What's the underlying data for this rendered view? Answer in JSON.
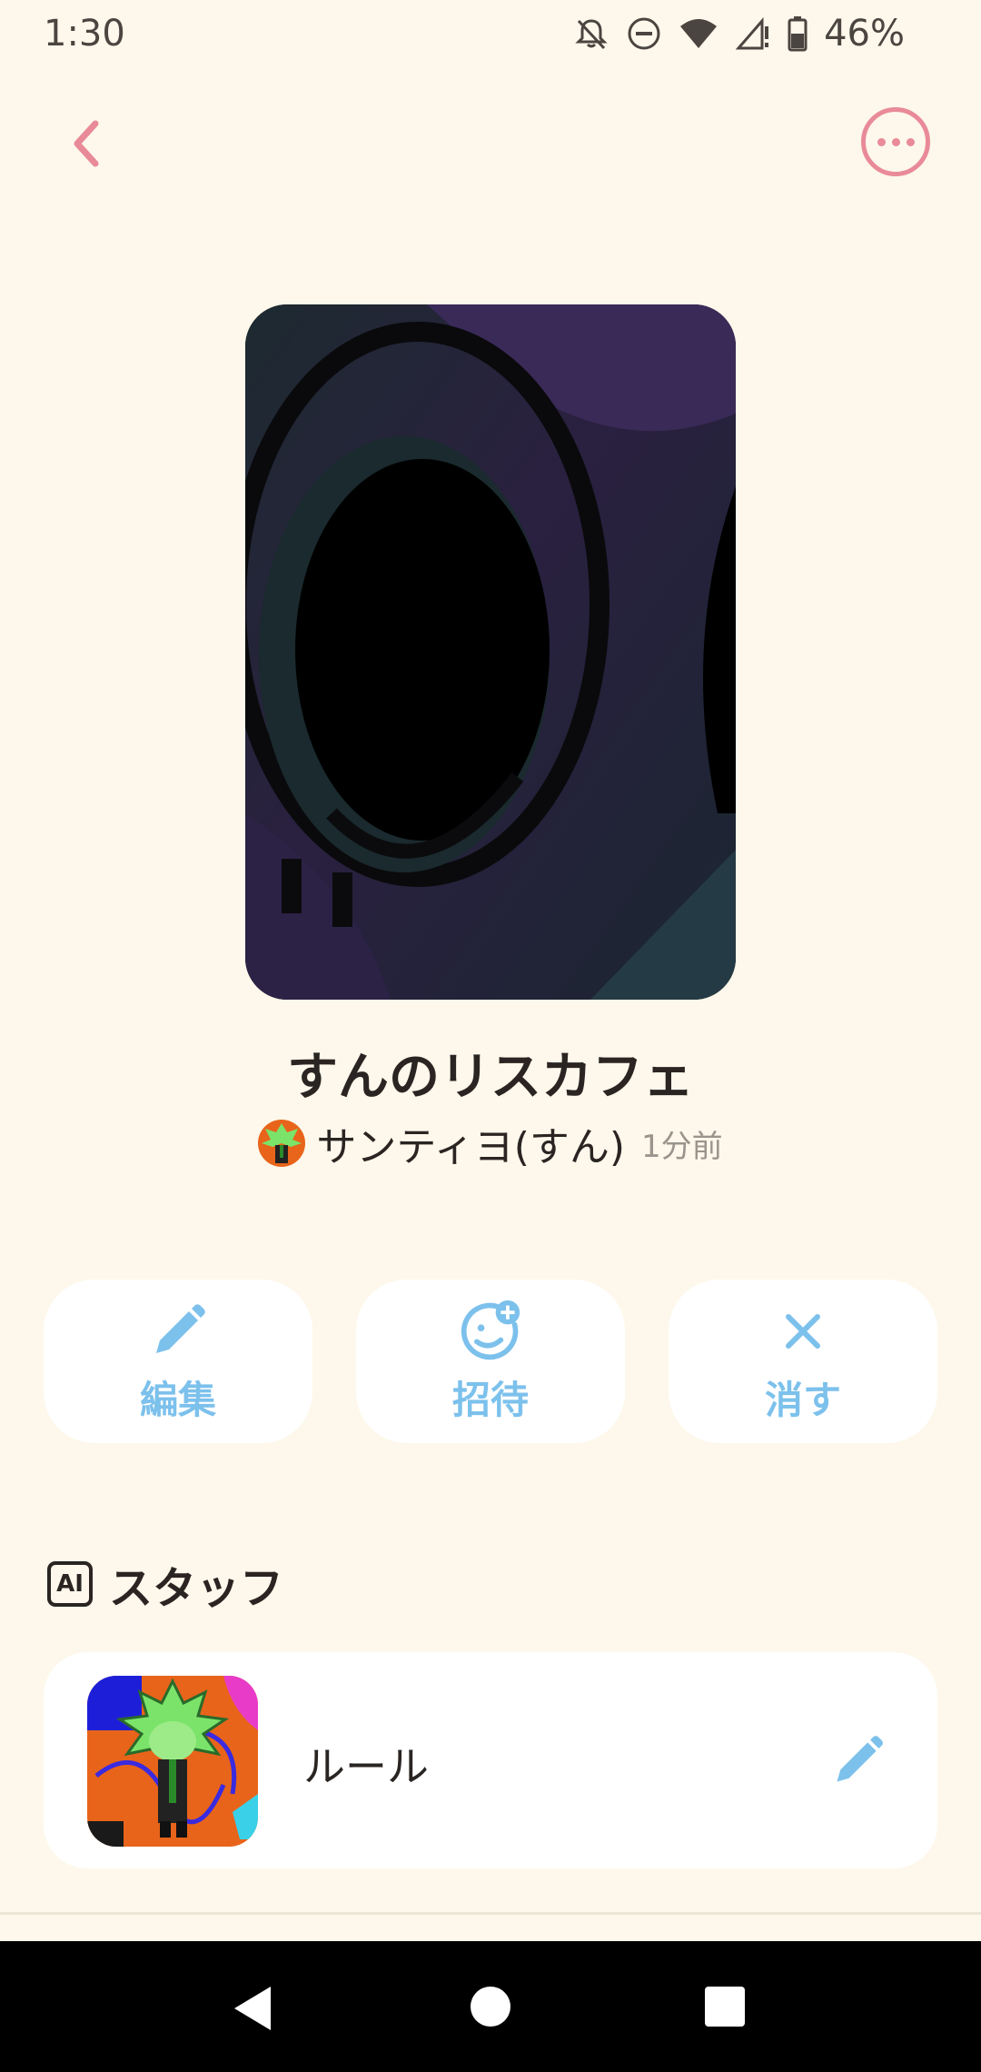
{
  "status_bar": {
    "time": "1:30",
    "battery_percent": "46%",
    "icons": [
      "bell-off-icon",
      "do-not-disturb-icon",
      "wifi-icon",
      "signal-icon",
      "battery-icon"
    ]
  },
  "header": {
    "back_icon": "chevron-left-icon",
    "more_icon": "more-horizontal-icon"
  },
  "room": {
    "title": "すんのリスカフェ",
    "owner_name": "サンティヨ(すん)",
    "updated": "1分前"
  },
  "actions": [
    {
      "label": "編集",
      "icon": "pencil-icon"
    },
    {
      "label": "招待",
      "icon": "add-friend-icon"
    },
    {
      "label": "消す",
      "icon": "close-icon"
    }
  ],
  "staff": {
    "badge": "AI",
    "title": "スタッフ",
    "items": [
      {
        "name": "ルール",
        "edit_icon": "pencil-icon"
      }
    ]
  },
  "colors": {
    "background": "#FDF8EB",
    "accent_pink": "#E98A99",
    "accent_blue": "#7CC1EC",
    "card": "#FFFFFF"
  }
}
